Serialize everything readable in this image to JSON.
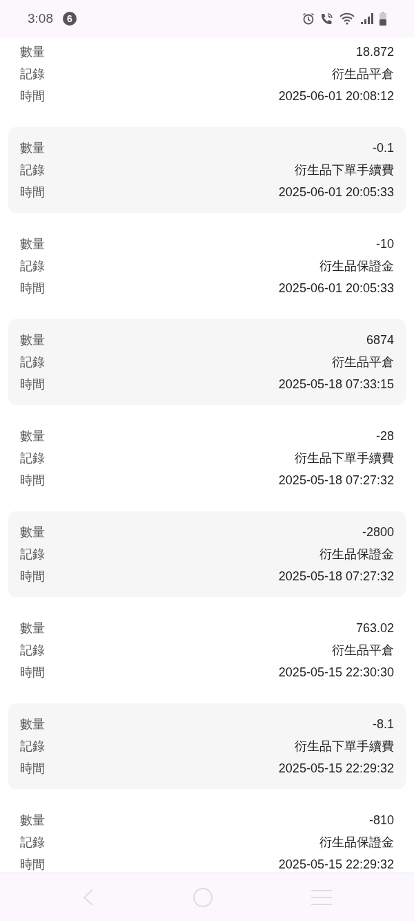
{
  "status_bar": {
    "time": "3:08",
    "notification_count": "6"
  },
  "records": [
    {
      "quantity_label": "數量",
      "quantity": "18.872",
      "record_label": "記錄",
      "record": "衍生品平倉",
      "time_label": "時間",
      "time": "2025-06-01 20:08:12"
    },
    {
      "quantity_label": "數量",
      "quantity": "-0.1",
      "record_label": "記錄",
      "record": "衍生品下單手續費",
      "time_label": "時間",
      "time": "2025-06-01 20:05:33"
    },
    {
      "quantity_label": "數量",
      "quantity": "-10",
      "record_label": "記錄",
      "record": "衍生品保證金",
      "time_label": "時間",
      "time": "2025-06-01 20:05:33"
    },
    {
      "quantity_label": "數量",
      "quantity": "6874",
      "record_label": "記錄",
      "record": "衍生品平倉",
      "time_label": "時間",
      "time": "2025-05-18 07:33:15"
    },
    {
      "quantity_label": "數量",
      "quantity": "-28",
      "record_label": "記錄",
      "record": "衍生品下單手續費",
      "time_label": "時間",
      "time": "2025-05-18 07:27:32"
    },
    {
      "quantity_label": "數量",
      "quantity": "-2800",
      "record_label": "記錄",
      "record": "衍生品保證金",
      "time_label": "時間",
      "time": "2025-05-18 07:27:32"
    },
    {
      "quantity_label": "數量",
      "quantity": "763.02",
      "record_label": "記錄",
      "record": "衍生品平倉",
      "time_label": "時間",
      "time": "2025-05-15 22:30:30"
    },
    {
      "quantity_label": "數量",
      "quantity": "-8.1",
      "record_label": "記錄",
      "record": "衍生品下單手續費",
      "time_label": "時間",
      "time": "2025-05-15 22:29:32"
    },
    {
      "quantity_label": "數量",
      "quantity": "-810",
      "record_label": "記錄",
      "record": "衍生品保證金",
      "time_label": "時間",
      "time": "2025-05-15 22:29:32"
    }
  ]
}
